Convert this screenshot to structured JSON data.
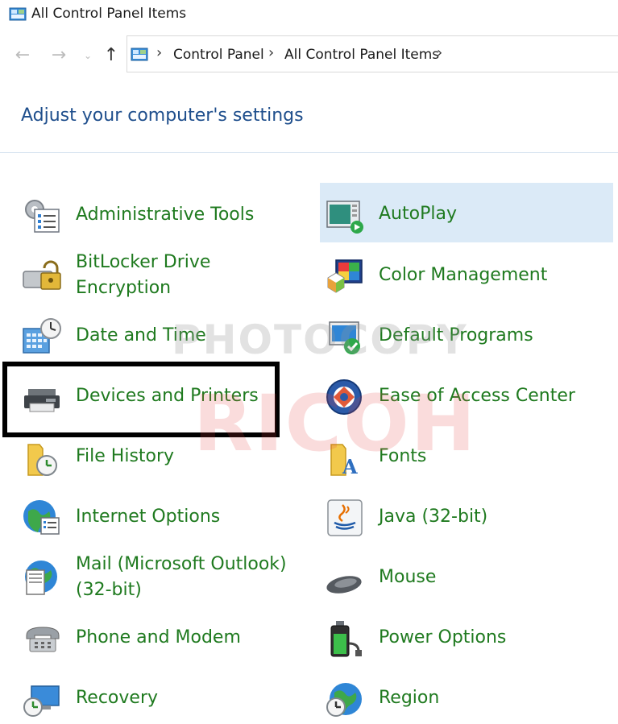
{
  "window": {
    "title": "All Control Panel Items"
  },
  "address_bar": {
    "crumbs": [
      "Control Panel",
      "All Control Panel Items"
    ]
  },
  "heading": "Adjust your computer's settings",
  "items": {
    "administrative_tools": "Administrative Tools",
    "autoplay": "AutoPlay",
    "bitlocker": [
      "BitLocker Drive",
      "Encryption"
    ],
    "color_management": "Color Management",
    "date_time": "Date and Time",
    "default_programs": "Default Programs",
    "devices_printers": "Devices and Printers",
    "ease_of_access": "Ease of Access Center",
    "file_history": "File History",
    "fonts": "Fonts",
    "internet_options": "Internet Options",
    "java": "Java (32-bit)",
    "mail": [
      "Mail (Microsoft Outlook)",
      "(32-bit)"
    ],
    "mouse": "Mouse",
    "phone_modem": "Phone and Modem",
    "power_options": "Power Options",
    "recovery": "Recovery",
    "region": "Region"
  },
  "watermark": {
    "line1": "PHOTOCOPY",
    "line2": "RICOH"
  },
  "colors": {
    "link_green": "#1f7a1f",
    "heading_blue": "#1e4e8c",
    "hover_bg": "#dbeaf7"
  }
}
